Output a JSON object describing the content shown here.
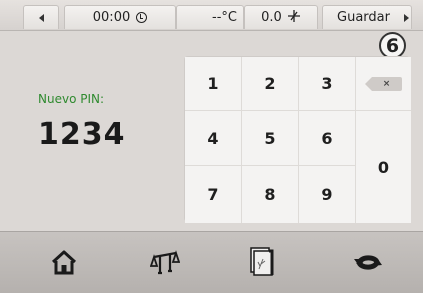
{
  "status_bar": {
    "time": "00:00",
    "temperature": "--°C",
    "fan_speed": "0.0",
    "save_label": "Guardar"
  },
  "badge": "6",
  "pin": {
    "label": "Nuevo PIN:",
    "value": "1234"
  },
  "keypad": {
    "keys": [
      "1",
      "2",
      "3",
      "4",
      "5",
      "6",
      "7",
      "8",
      "9"
    ],
    "zero": "0",
    "backspace_icon": "backspace-icon",
    "backspace_glyph": "×"
  },
  "nav": {
    "icons": [
      "home-icon",
      "scale-icon",
      "recipe-book-icon",
      "cycle-icon"
    ]
  },
  "colors": {
    "pin_label": "#2f8a2f",
    "background": "#dcd8d5"
  }
}
